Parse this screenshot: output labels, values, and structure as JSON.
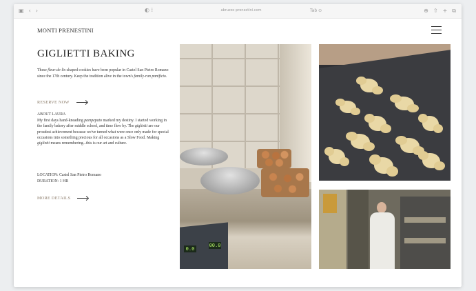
{
  "browser": {
    "address": "abruzzo-prenestini.com",
    "reader": "Tab ⊙"
  },
  "site": {
    "brand": "MONTI PRENESTINI",
    "title": "GIGLIETTI BAKING",
    "intro_pre": "These ",
    "intro_em1": "fleur-de-lis",
    "intro_mid": "-shaped cookies have been popular in Castel San Pietro Romano since the 17th century. Keep the tradition alive in the town's ",
    "intro_em2": "family-run panificio",
    "intro_post": ".",
    "reserve_label": "RESERVE NOW",
    "about_heading": "ABOUT LAURA",
    "about_1": "My first days hand-kneading ",
    "about_em1": "pampepato",
    "about_2": " marked my destiny. I started working in the family bakery after middle school, and time flew by. The ",
    "about_em2": "giglietti",
    "about_3": " are our proudest achievement because we've turned what were once only made for special occasions into something precious for all occasions as a Slow Food. Making ",
    "about_em3": "giglietti",
    "about_4": " means remembering...this is our art and culture.",
    "location": "LOCATION: Castel San Pietro Romano",
    "duration": "DURATION: 1 HR",
    "details_label": "MORE DETAILS"
  },
  "scale_display": [
    "0.0",
    "00.0"
  ],
  "colors": {
    "link": "#8a7a68",
    "text": "#333333"
  }
}
